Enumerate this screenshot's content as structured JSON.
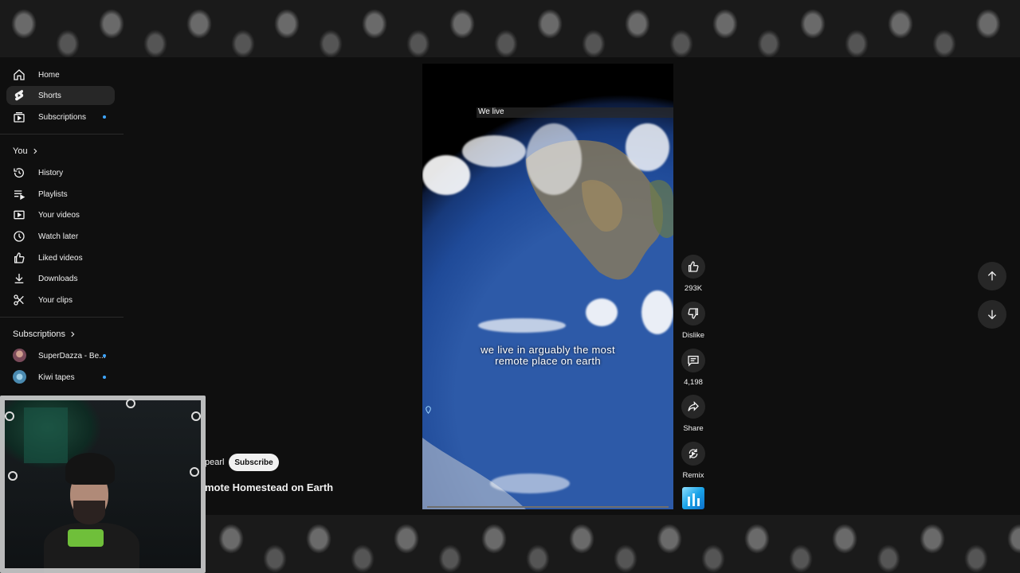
{
  "sidebar": {
    "main": [
      {
        "label": "Home",
        "icon": "home-icon",
        "active": false,
        "dot": false
      },
      {
        "label": "Shorts",
        "icon": "shorts-icon",
        "active": true,
        "dot": false
      },
      {
        "label": "Subscriptions",
        "icon": "subscriptions-icon",
        "active": false,
        "dot": true
      }
    ],
    "you_title": "You",
    "you": [
      {
        "label": "History",
        "icon": "history-icon"
      },
      {
        "label": "Playlists",
        "icon": "playlists-icon"
      },
      {
        "label": "Your videos",
        "icon": "your-videos-icon"
      },
      {
        "label": "Watch later",
        "icon": "watch-later-icon"
      },
      {
        "label": "Liked videos",
        "icon": "liked-videos-icon"
      },
      {
        "label": "Downloads",
        "icon": "downloads-icon"
      },
      {
        "label": "Your clips",
        "icon": "scissors-icon"
      }
    ],
    "subscriptions_title": "Subscriptions",
    "subscriptions": [
      {
        "label": "SuperDazza - Be...",
        "dot": true,
        "color": "#7a4a5a"
      },
      {
        "label": "Kiwi tapes",
        "dot": true,
        "color": "#4a8ab0"
      }
    ]
  },
  "player": {
    "top_caption": "We live",
    "subtitle_line1": "we live in arguably the most",
    "subtitle_line2": "remote place on earth"
  },
  "actions": {
    "likes": "293K",
    "dislike": "Dislike",
    "comments": "4,198",
    "share": "Share",
    "remix": "Remix"
  },
  "channel": {
    "name_fragment": "pearl",
    "subscribe_label": "Subscribe",
    "title_fragment": "mote Homestead on Earth"
  },
  "colors": {
    "background": "#0f0f0f",
    "accent_dot": "#3ea6ff",
    "button_bg": "#272727"
  }
}
